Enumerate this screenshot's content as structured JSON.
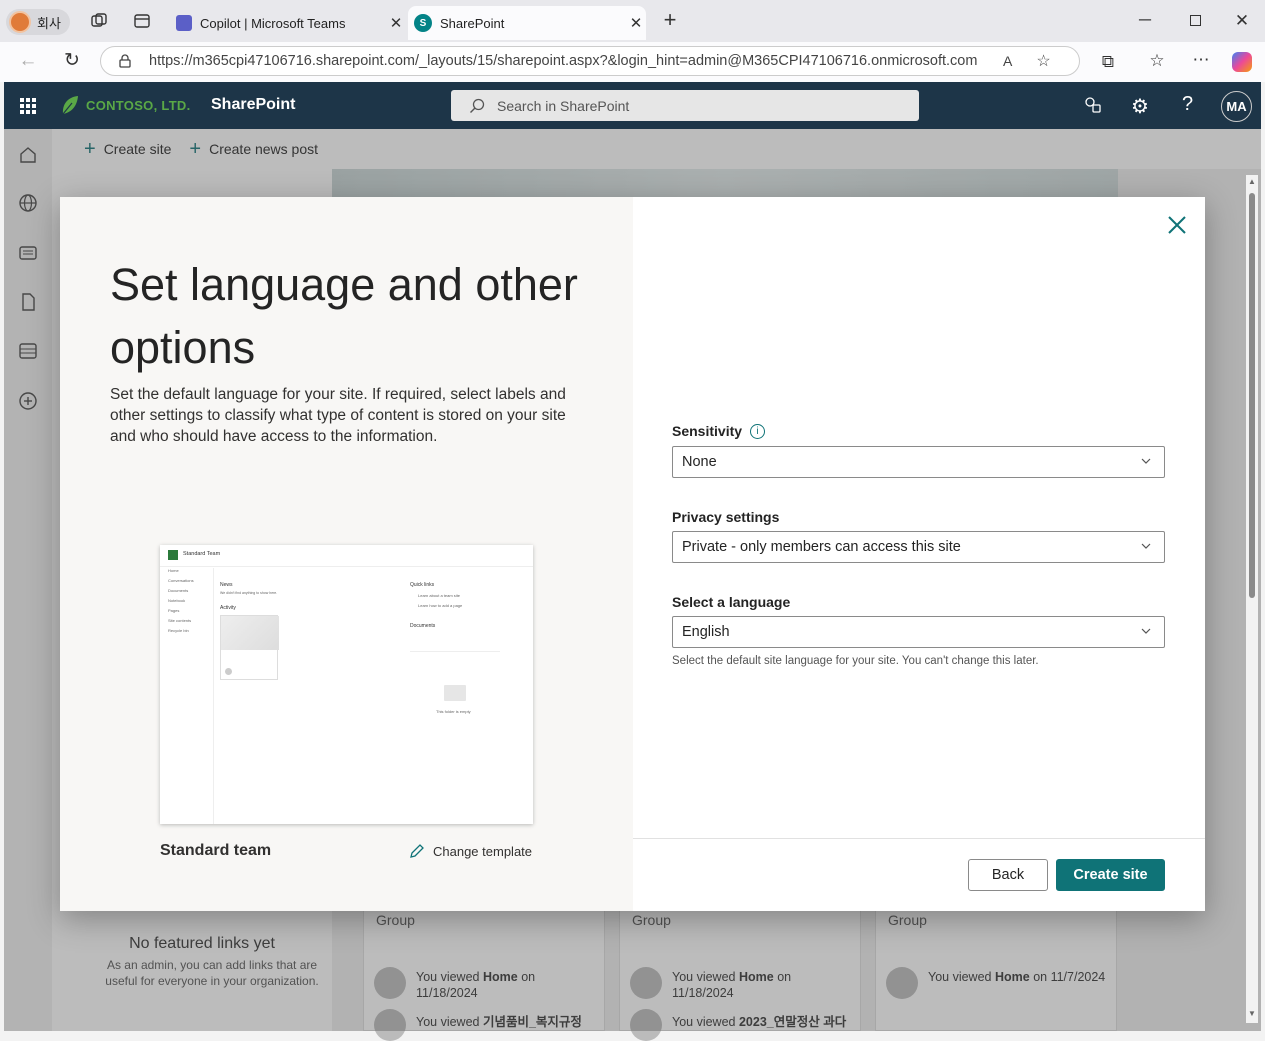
{
  "browser": {
    "profile_label": "회사",
    "tabs": [
      {
        "title": "Copilot | Microsoft Teams",
        "active": false
      },
      {
        "title": "SharePoint",
        "active": true
      }
    ],
    "url": "https://m365cpi47106716.sharepoint.com/_layouts/15/sharepoint.aspx?&login_hint=admin@M365CPI47106716.onmicrosoft.com"
  },
  "suite": {
    "org_name": "CONTOSO, LTD.",
    "app_name": "SharePoint",
    "search_placeholder": "Search in SharePoint",
    "avatar_initials": "MA",
    "help": "?"
  },
  "command_bar": {
    "create_site": "Create site",
    "create_news_post": "Create news post"
  },
  "dialog": {
    "title": "Set language and other options",
    "description": "Set the default language for your site. If required, select labels and other settings to classify what type of content is stored on your site and who should have access to the information.",
    "template_name": "Standard team",
    "change_template": "Change template",
    "sensitivity_label": "Sensitivity",
    "sensitivity_value": "None",
    "privacy_label": "Privacy settings",
    "privacy_value": "Private - only members can access this site",
    "language_label": "Select a language",
    "language_value": "English",
    "language_hint": "Select the default site language for your site. You can't change this later.",
    "back_button": "Back",
    "create_button": "Create site"
  },
  "preview": {
    "site_title": "Standard Team",
    "nav": [
      "Home",
      "Conversations",
      "Documents",
      "Notebook",
      "Pages",
      "Site contents",
      "Recycle bin"
    ],
    "news": "News",
    "news_empty": "We didn't find anything to show here.",
    "activity": "Activity",
    "quick_links": "Quick links",
    "quick_link_items": [
      "Learn about a team site",
      "Learn how to add a page"
    ],
    "documents": "Documents",
    "empty_folder": "This folder is empty"
  },
  "background": {
    "featured_title": "No featured links yet",
    "featured_desc": "As an admin, you can add links that are useful for everyone in your organization.",
    "cards": [
      {
        "group": "Group",
        "activity_prefix": "You viewed",
        "activity_bold": "Home",
        "activity_suffix": "on 11/18/2024",
        "activity2_prefix": "You viewed",
        "activity2_bold": "기념품비_복지규정"
      },
      {
        "group": "Group",
        "activity_prefix": "You viewed",
        "activity_bold": "Home",
        "activity_suffix": "on 11/18/2024",
        "activity2_prefix": "You viewed",
        "activity2_bold": "2023_연말정산 과다"
      },
      {
        "group": "Group",
        "activity_prefix": "You viewed",
        "activity_bold": "Home",
        "activity_suffix": "on 11/7/2024"
      }
    ]
  },
  "colors": {
    "suite_bg": "#1d3548",
    "accent": "#0f7377",
    "org_green": "#5aa846"
  }
}
